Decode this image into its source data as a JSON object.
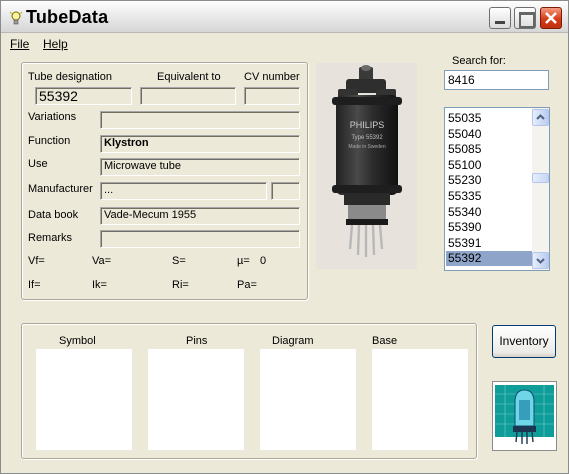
{
  "window": {
    "title": "TubeData"
  },
  "menu": {
    "file": "File",
    "help": "Help"
  },
  "details": {
    "tube_designation_label": "Tube designation",
    "tube_designation_value": "55392",
    "equivalent_label": "Equivalent to",
    "equivalent_value": "",
    "cv_label": "CV number",
    "cv_value": "",
    "variations_label": "Variations",
    "variations_value": "",
    "function_label": "Function",
    "function_value": "Klystron",
    "use_label": "Use",
    "use_value": "Microwave tube",
    "manufacturer_label": "Manufacturer",
    "manufacturer_value": "...",
    "databook_label": "Data book",
    "databook_value": "Vade-Mecum 1955",
    "remarks_label": "Remarks",
    "remarks_value": ""
  },
  "params": {
    "vf": "Vf=",
    "va": "Va=",
    "s": "S=",
    "mu": "µ=",
    "mu_value": "0",
    "if": "If=",
    "ik": "Ik=",
    "ri": "Ri=",
    "pa": "Pa="
  },
  "photo": {
    "brand": "PHILIPS",
    "type_line": "Type 55392",
    "origin": "Made in Sweden"
  },
  "search": {
    "label": "Search for:",
    "value": "8416",
    "results": [
      "55035",
      "55040",
      "55085",
      "55100",
      "55230",
      "55335",
      "55340",
      "55390",
      "55391",
      "55392"
    ],
    "selected": "55392"
  },
  "panels": {
    "symbol": "Symbol",
    "pins": "Pins",
    "diagram": "Diagram",
    "base": "Base"
  },
  "inventory_button": "Inventory",
  "colors": {
    "selection": "#8ea4c8",
    "close_button": "#d63b18",
    "logo_bg": "#0f9d9a"
  }
}
